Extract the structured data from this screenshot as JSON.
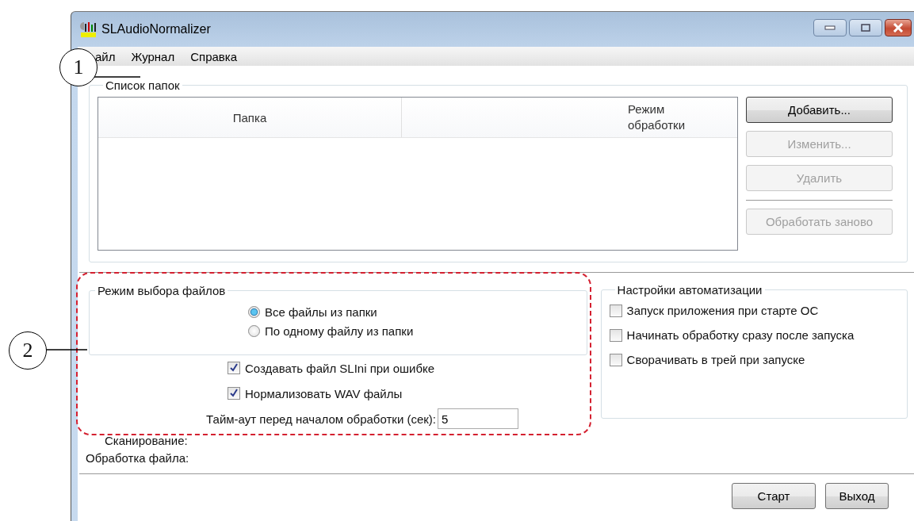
{
  "window": {
    "title": "SLAudioNormalizer"
  },
  "menu": [
    {
      "label": "айл"
    },
    {
      "label": "Журнал"
    },
    {
      "label": "Справка"
    }
  ],
  "folders": {
    "title": "Список папок",
    "columns": [
      "Папка",
      "Режим обработки"
    ],
    "buttons": [
      {
        "label": "Добавить...",
        "disabled": false
      },
      {
        "label": "Изменить...",
        "disabled": true
      },
      {
        "label": "Удалить",
        "disabled": true
      },
      {
        "label": "Обработать заново",
        "disabled": true
      }
    ]
  },
  "file_mode": {
    "title": "Режим выбора файлов",
    "options": [
      {
        "label": "Все файлы из папки",
        "selected": true
      },
      {
        "label": "По одному файлу из папки",
        "selected": false
      }
    ]
  },
  "options": [
    {
      "label": "Создавать файл SLIni при ошибке",
      "checked": true
    },
    {
      "label": "Нормализовать WAV файлы",
      "checked": true
    }
  ],
  "timeout": {
    "label": "Тайм-аут перед началом обработки (сек):",
    "value": "5"
  },
  "automation": {
    "title": "Настройки автоматизации",
    "options": [
      {
        "label": "Запуск приложения при старте ОС",
        "checked": false
      },
      {
        "label": "Начинать обработку сразу после запуска",
        "checked": false
      },
      {
        "label": "Сворачивать в трей при запуске",
        "checked": false
      }
    ]
  },
  "status": [
    {
      "label": "Сканирование:"
    },
    {
      "label": "Обработка файла:"
    }
  ],
  "buttons": [
    {
      "label": "Старт"
    },
    {
      "label": "Выход"
    }
  ],
  "callouts": [
    "1",
    "2"
  ]
}
